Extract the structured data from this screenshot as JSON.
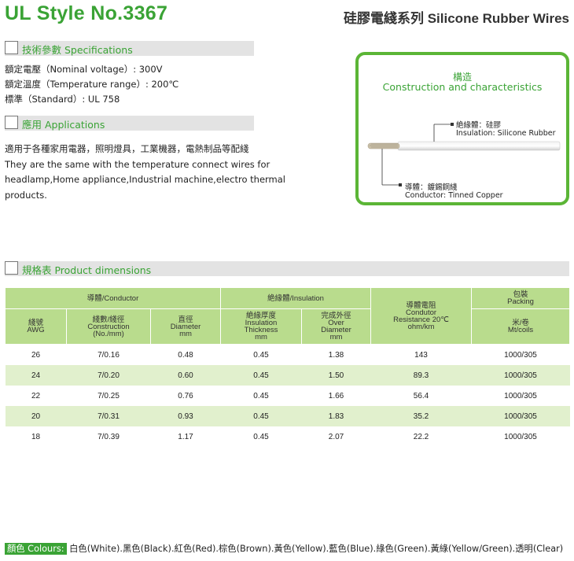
{
  "header": {
    "title": "UL Style No.3367",
    "subtitle": "硅膠電綫系列 Silicone Rubber Wires"
  },
  "sections": {
    "specifications": "技術參數 Specifications",
    "applications": "應用 Applications",
    "dimensions": "規格表 Product dimensions"
  },
  "specs": [
    "額定電壓（Nominal voltage）: 300V",
    "額定溫度（Temperature range）: 200℃",
    "標準（Standard）: UL 758"
  ],
  "applications_text": [
    "適用于各種家用電器，照明燈具，工業機器，電熱制品等配綫",
    "They are the same with the temperature connect wires for",
    "headlamp,Home appliance,Industrial machine,electro thermal",
    "products."
  ],
  "construction": {
    "title_cn": "構造",
    "title_en": "Construction and characteristics",
    "insulation_cn": "絶緣體：硅膠",
    "insulation_en": "Insulation: Silicone Rubber",
    "conductor_cn": "導體：鍍錫銅綫",
    "conductor_en": "Conductor: Tinned Copper"
  },
  "table": {
    "group_headers": {
      "conductor": "導體/Conductor",
      "insulation": "絶緣體/Insulation",
      "resistance": [
        "導體電阻",
        "Condutor",
        "Resistance 20℃",
        "ohm/km"
      ],
      "packing": [
        "包裝",
        "Packing"
      ]
    },
    "sub_headers": {
      "awg": [
        "綫號",
        "AWG"
      ],
      "construction": [
        "綫數/綫徑",
        "Construction",
        "(No./mm)"
      ],
      "diameter": [
        "直徑",
        "Diameter",
        "mm"
      ],
      "thickness": [
        "絶緣厚度",
        "Insulation",
        "Thickness",
        "mm"
      ],
      "over_diameter": [
        "完成外徑",
        "Over",
        "Diameter",
        "mm"
      ],
      "packing_unit": [
        "米/卷",
        "Mt/coils"
      ]
    },
    "rows": [
      [
        "26",
        "7/0.16",
        "0.48",
        "0.45",
        "1.38",
        "143",
        "1000/305"
      ],
      [
        "24",
        "7/0.20",
        "0.60",
        "0.45",
        "1.50",
        "89.3",
        "1000/305"
      ],
      [
        "22",
        "7/0.25",
        "0.76",
        "0.45",
        "1.66",
        "56.4",
        "1000/305"
      ],
      [
        "20",
        "7/0.31",
        "0.93",
        "0.45",
        "1.83",
        "35.2",
        "1000/305"
      ],
      [
        "18",
        "7/0.39",
        "1.17",
        "0.45",
        "2.07",
        "22.2",
        "1000/305"
      ]
    ]
  },
  "colors": {
    "label": "顏色 Colours:",
    "text": "白色(White).黑色(Black).紅色(Red).棕色(Brown).黃色(Yellow).藍色(Blue).綠色(Green).黃綠(Yellow/Green).透明(Clear)"
  },
  "theme": {
    "accent": "#3aa335",
    "header_bg": "#b9dc8d",
    "row_alt": "#e1f0cd",
    "frame": "#5bb536"
  }
}
